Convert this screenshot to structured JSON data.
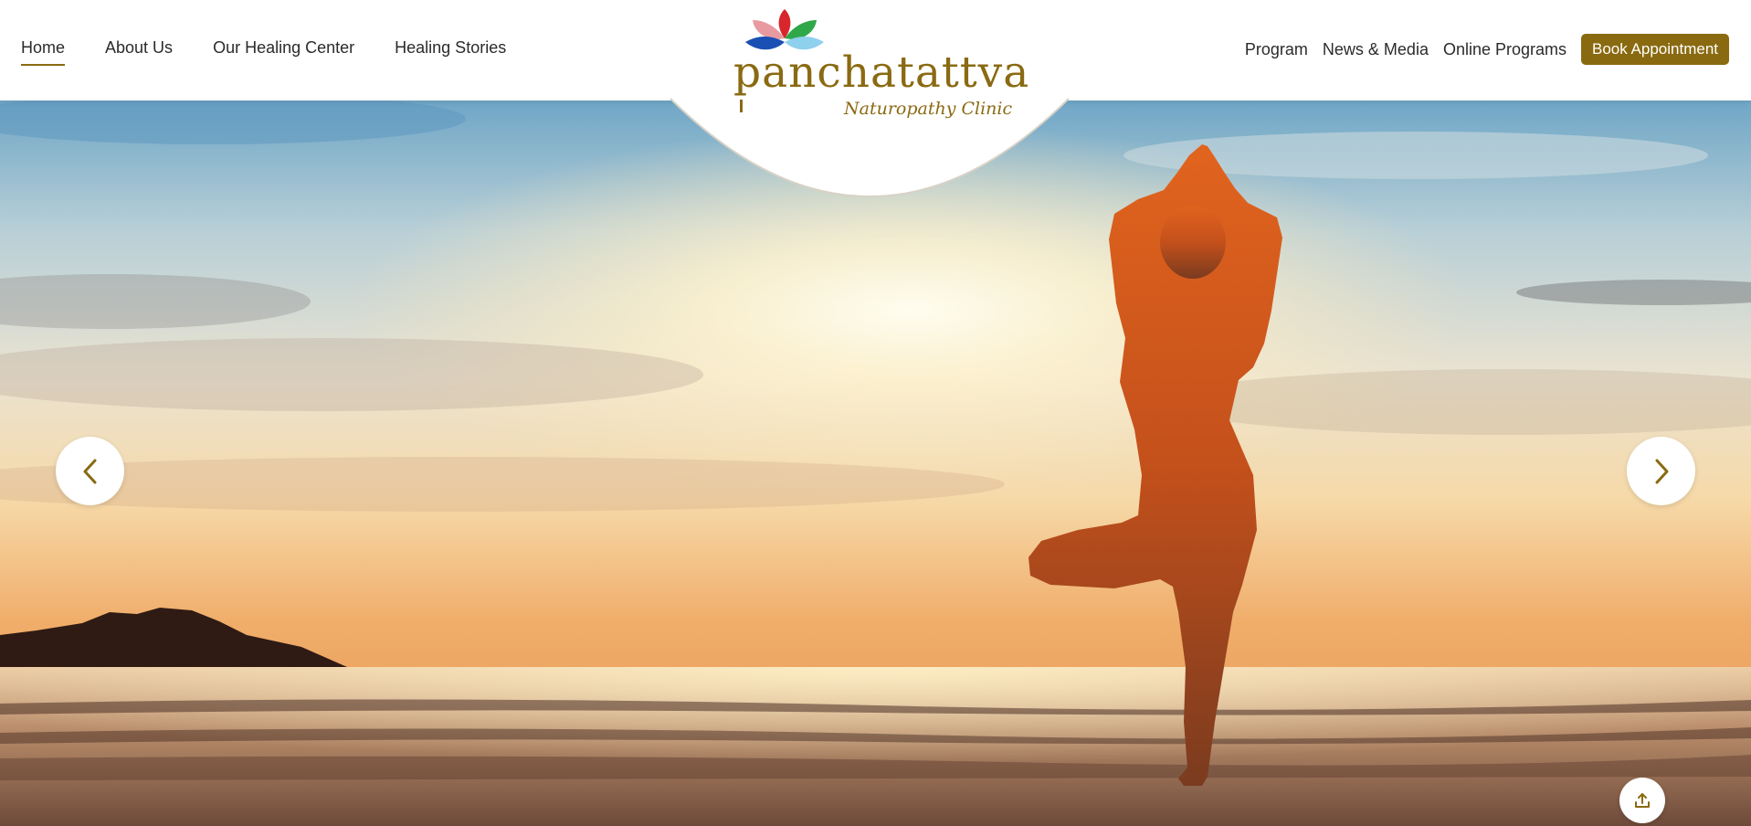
{
  "nav_left": [
    {
      "label": "Home",
      "active": true
    },
    {
      "label": "About Us",
      "active": false
    },
    {
      "label": "Our Healing Center",
      "active": false
    },
    {
      "label": "Healing Stories",
      "active": false
    }
  ],
  "nav_right": [
    {
      "label": "Program"
    },
    {
      "label": "News & Media"
    },
    {
      "label": "Online Programs"
    }
  ],
  "cta": {
    "label": "Book Appointment"
  },
  "logo": {
    "name": "panchatattva",
    "tagline": "Naturopathy Clinic"
  },
  "hero": {
    "image": "silhouette of person in tree yoga pose on beach at sunset"
  },
  "carousel": {
    "prev_icon": "chevron-left-icon",
    "next_icon": "chevron-right-icon"
  },
  "share": {
    "icon": "share-upload-icon"
  },
  "colors": {
    "brand": "#8a6a10",
    "text": "#2b2b2b",
    "background": "#ffffff"
  }
}
